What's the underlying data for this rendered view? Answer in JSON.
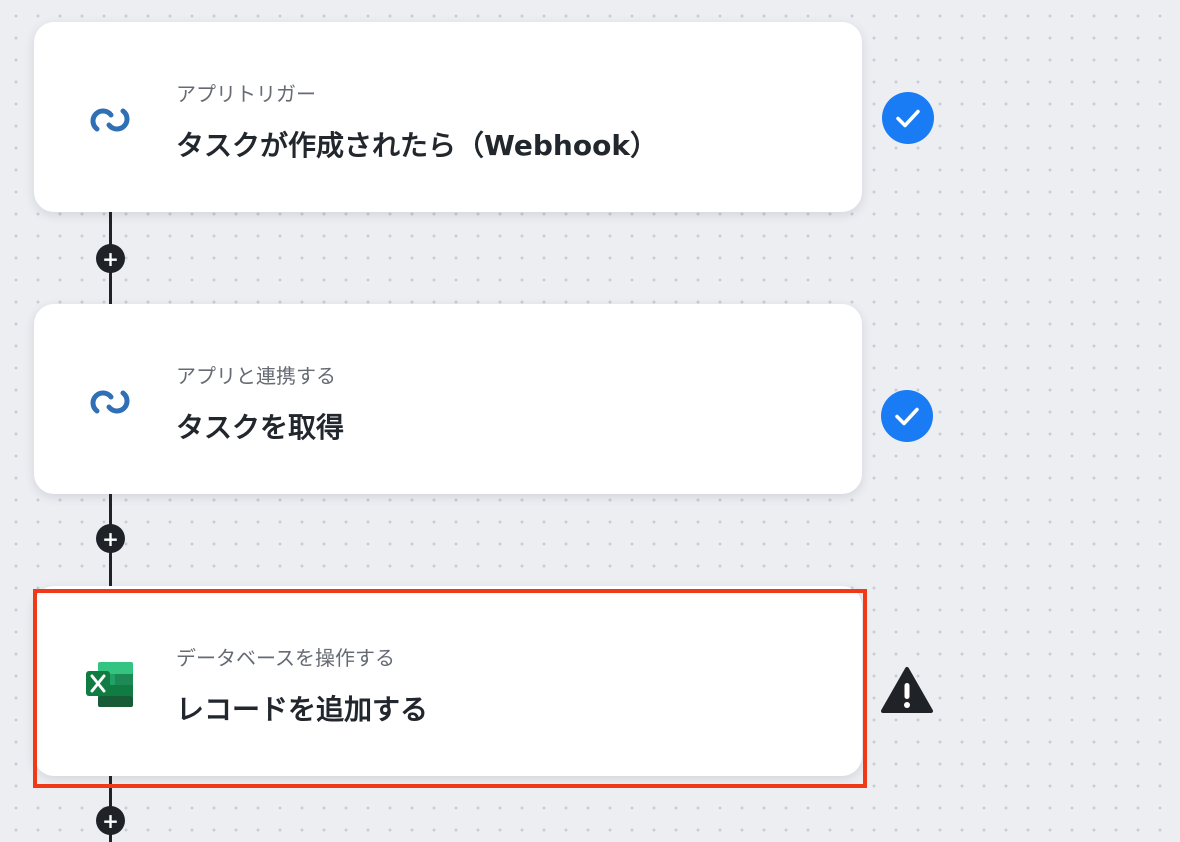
{
  "colors": {
    "canvas_background": "#eceef2",
    "card_background": "#ffffff",
    "connector": "#1f2328",
    "status_complete": "#1a7cf4",
    "status_warning": "#1f2328",
    "highlight_frame": "#f03a17",
    "subtitle_text": "#666b73",
    "title_text": "#22272e"
  },
  "steps": [
    {
      "subtitle": "アプリトリガー",
      "title": "タスクが作成されたら（Webhook）",
      "app_icon": "chain-link-icon",
      "status": "complete",
      "status_icon": "checkmark-icon"
    },
    {
      "subtitle": "アプリと連携する",
      "title": "タスクを取得",
      "app_icon": "chain-link-icon",
      "status": "complete",
      "status_icon": "checkmark-icon"
    },
    {
      "subtitle": "データベースを操作する",
      "title": "レコードを追加する",
      "app_icon": "excel-icon",
      "status": "warning",
      "status_icon": "warning-icon",
      "highlighted": true
    }
  ],
  "add_step_button": {
    "label": "+",
    "icon": "plus-icon"
  }
}
